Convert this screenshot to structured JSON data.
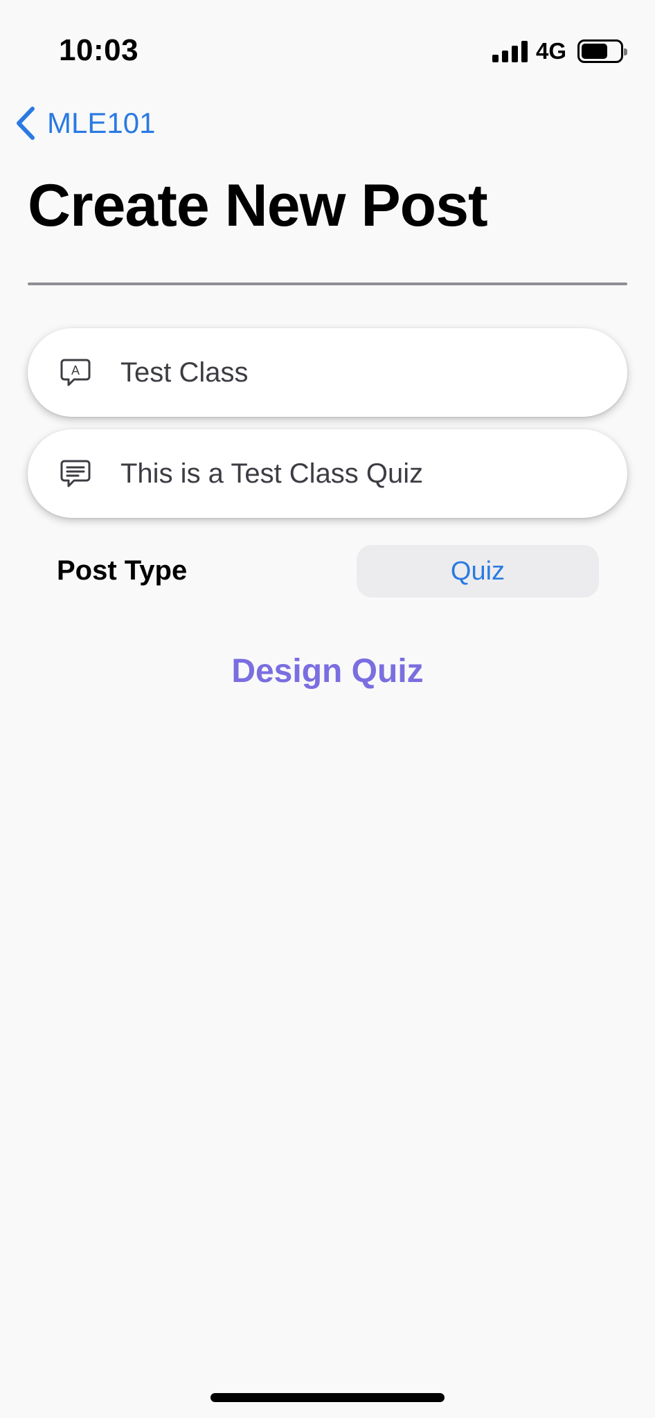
{
  "status_bar": {
    "time": "10:03",
    "network": "4G",
    "icons": [
      "signal-bars",
      "battery"
    ]
  },
  "nav": {
    "back_label": "MLE101",
    "back_icon": "chevron-left",
    "accent_color": "#2a7ae2"
  },
  "page": {
    "title": "Create New Post"
  },
  "form": {
    "title_field": {
      "value": "Test Class",
      "icon": "speech-bubble-letter-a"
    },
    "description_field": {
      "value": "This is a Test Class Quiz",
      "icon": "speech-bubble-text-lines"
    },
    "post_type": {
      "label": "Post Type",
      "selected": "Quiz"
    }
  },
  "actions": {
    "design_quiz_label": "Design Quiz",
    "design_quiz_color": "#7a6ee0"
  }
}
